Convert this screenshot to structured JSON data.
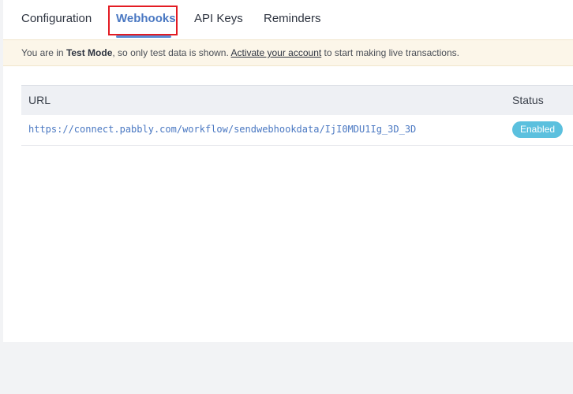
{
  "tabs": [
    {
      "label": "Configuration"
    },
    {
      "label": "Webhooks"
    },
    {
      "label": "API Keys"
    },
    {
      "label": "Reminders"
    }
  ],
  "banner": {
    "prefix": "You are in ",
    "mode": "Test Mode",
    "middle": ", so only test data is shown. ",
    "link": "Activate your account",
    "suffix": " to start making live transactions."
  },
  "table": {
    "headers": {
      "url": "URL",
      "status": "Status"
    },
    "rows": [
      {
        "url": "https://connect.pabbly.com/workflow/sendwebhookdata/IjI0MDU1Ig_3D_3D",
        "status": "Enabled"
      }
    ]
  },
  "colors": {
    "accent": "#4a78c2",
    "badge": "#5bc0de",
    "banner_bg": "#fcf6e9",
    "highlight": "#e31b23"
  }
}
